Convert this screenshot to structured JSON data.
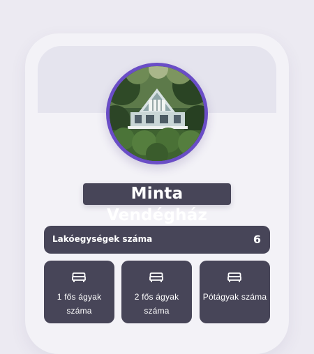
{
  "profile": {
    "name": "Minta Vendégház",
    "avatar_icon": "guesthouse-photo"
  },
  "stats": {
    "units_label": "Lakóegységek száma",
    "units_value": "6"
  },
  "beds": [
    {
      "label": "1 fős ágyak száma",
      "icon": "bed-icon"
    },
    {
      "label": "2 fős ágyak száma",
      "icon": "bed-icon"
    },
    {
      "label": "Pótágyak száma",
      "icon": "bed-icon"
    }
  ],
  "colors": {
    "accent": "#6a4dc6",
    "card": "#474558",
    "background": "#eceaf2"
  }
}
